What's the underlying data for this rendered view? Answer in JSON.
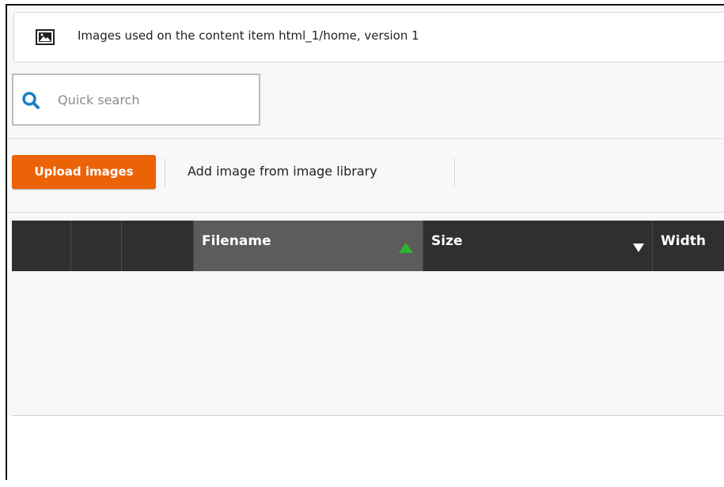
{
  "title_bar": {
    "icon": "image-icon",
    "title": "Images used on the content item html_1/home, version 1"
  },
  "search": {
    "icon": "search-icon",
    "placeholder": "Quick search"
  },
  "toolbar": {
    "upload_label": "Upload images",
    "library_label": "Add image from image library"
  },
  "table": {
    "columns": [
      {
        "label": "",
        "sort": "none"
      },
      {
        "label": "",
        "sort": "none"
      },
      {
        "label": "",
        "sort": "none"
      },
      {
        "label": "Filename",
        "sort": "ascending"
      },
      {
        "label": "Size",
        "sort": "descending-indicator"
      },
      {
        "label": "Width",
        "sort": "none"
      }
    ],
    "rows": []
  },
  "colors": {
    "accent": "#ec6307",
    "header_bg": "#2f2f2f",
    "sorted_header_bg": "#5c5c5c",
    "sort_ascending": "#2fb52f"
  }
}
